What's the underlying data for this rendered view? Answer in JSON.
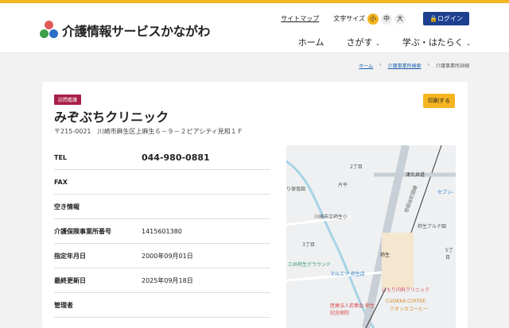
{
  "header": {
    "site_title": "介護情報サービスかながわ",
    "sitemap": "サイトマップ",
    "font_size_label": "文字サイズ",
    "font_sizes": [
      "小",
      "中",
      "大"
    ],
    "login": "ログイン",
    "nav": [
      "ホーム",
      "さがす",
      "学ぶ・はたらく"
    ]
  },
  "breadcrumb": [
    "ホーム",
    "介護事業所検索",
    "介護事業所詳細"
  ],
  "facility": {
    "badge": "訪問看護",
    "print": "印刷する",
    "name": "みぞぶちクリニック",
    "address": "〒215-0021　川崎市麻生区上麻生６－９－２ピアシティ見和１Ｆ"
  },
  "rows": [
    {
      "k": "TEL",
      "v": "044-980-0881"
    },
    {
      "k": "FAX",
      "v": ""
    },
    {
      "k": "空き情報",
      "v": ""
    },
    {
      "k": "介護保険事業所番号",
      "v": "1415601380"
    },
    {
      "k": "指定年月日",
      "v": "2000年09月01日"
    },
    {
      "k": "最終更新日",
      "v": "2025年09月18日"
    },
    {
      "k": "管理者",
      "v": ""
    }
  ],
  "map": {
    "labels": [
      "2丁目",
      "片平",
      "り保育園",
      "川崎市立柿生小",
      "3丁目",
      "三井柿生グラウンド",
      "マルエツ 柿生店",
      "柿生",
      "にもり内科クリニック",
      "CUOKKA COFFEE",
      "クオッカコーヒー",
      "医療法人若葉会 柿生記念病院",
      "世田谷町田線",
      "セブン-",
      "柿生アルナ園",
      "5丁目",
      "津久井道"
    ]
  }
}
